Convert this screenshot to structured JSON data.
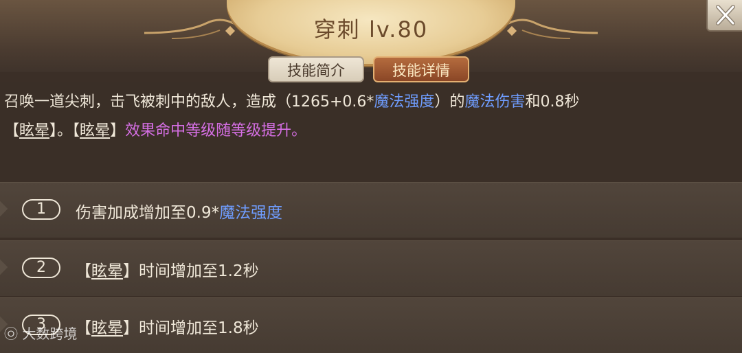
{
  "header": {
    "title": "穿刺 lv.80"
  },
  "tabs": [
    {
      "label": "技能简介"
    },
    {
      "label": "技能详情"
    }
  ],
  "description": {
    "line1_a": "召唤一道尖刺，击飞被刺中的敌人，造成（1265+0.6*",
    "line1_b": "魔法强度",
    "line1_c": "）的",
    "line1_d": "魔法伤害",
    "line1_e": "和0.8秒",
    "line2_a": "【",
    "line2_b": "眩晕",
    "line2_c": "】。【",
    "line2_d": "眩晕",
    "line2_e": "】",
    "line2_f": "效果命中等级随等级提升。"
  },
  "upgrades": [
    {
      "num": "1",
      "text_a": "伤害加成增加至0.9*",
      "text_b": "魔法强度"
    },
    {
      "num": "2",
      "text_a": "【",
      "text_b": "眩晕",
      "text_c": "】时间增加至1.2秒"
    },
    {
      "num": "3",
      "text_a": "【",
      "text_b": "眩晕",
      "text_c": "】时间增加至1.8秒"
    }
  ],
  "watermark": "大数跨境",
  "colors": {
    "highlight_blue": "#6f9dff",
    "highlight_purple": "#d66fe5",
    "active_tab": "#9c5530"
  },
  "icons": {
    "close": "close-icon"
  }
}
